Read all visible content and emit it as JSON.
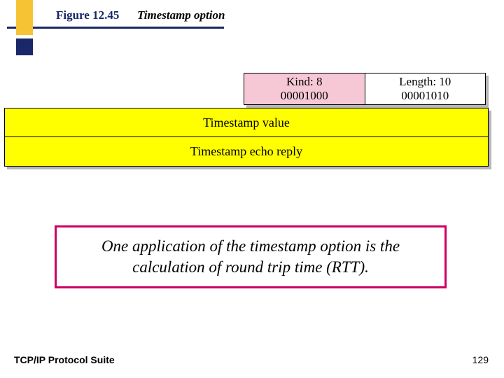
{
  "header": {
    "figure_label": "Figure 12.45",
    "figure_title": "Timestamp option"
  },
  "option": {
    "kind_label": "Kind: 8",
    "kind_bits": "00001000",
    "length_label": "Length: 10",
    "length_bits": "00001010",
    "row1": "Timestamp value",
    "row2": "Timestamp echo reply"
  },
  "callout": "One application of the timestamp option is the calculation of round trip time (RTT).",
  "footer": {
    "left": "TCP/IP Protocol Suite",
    "page": "129"
  }
}
